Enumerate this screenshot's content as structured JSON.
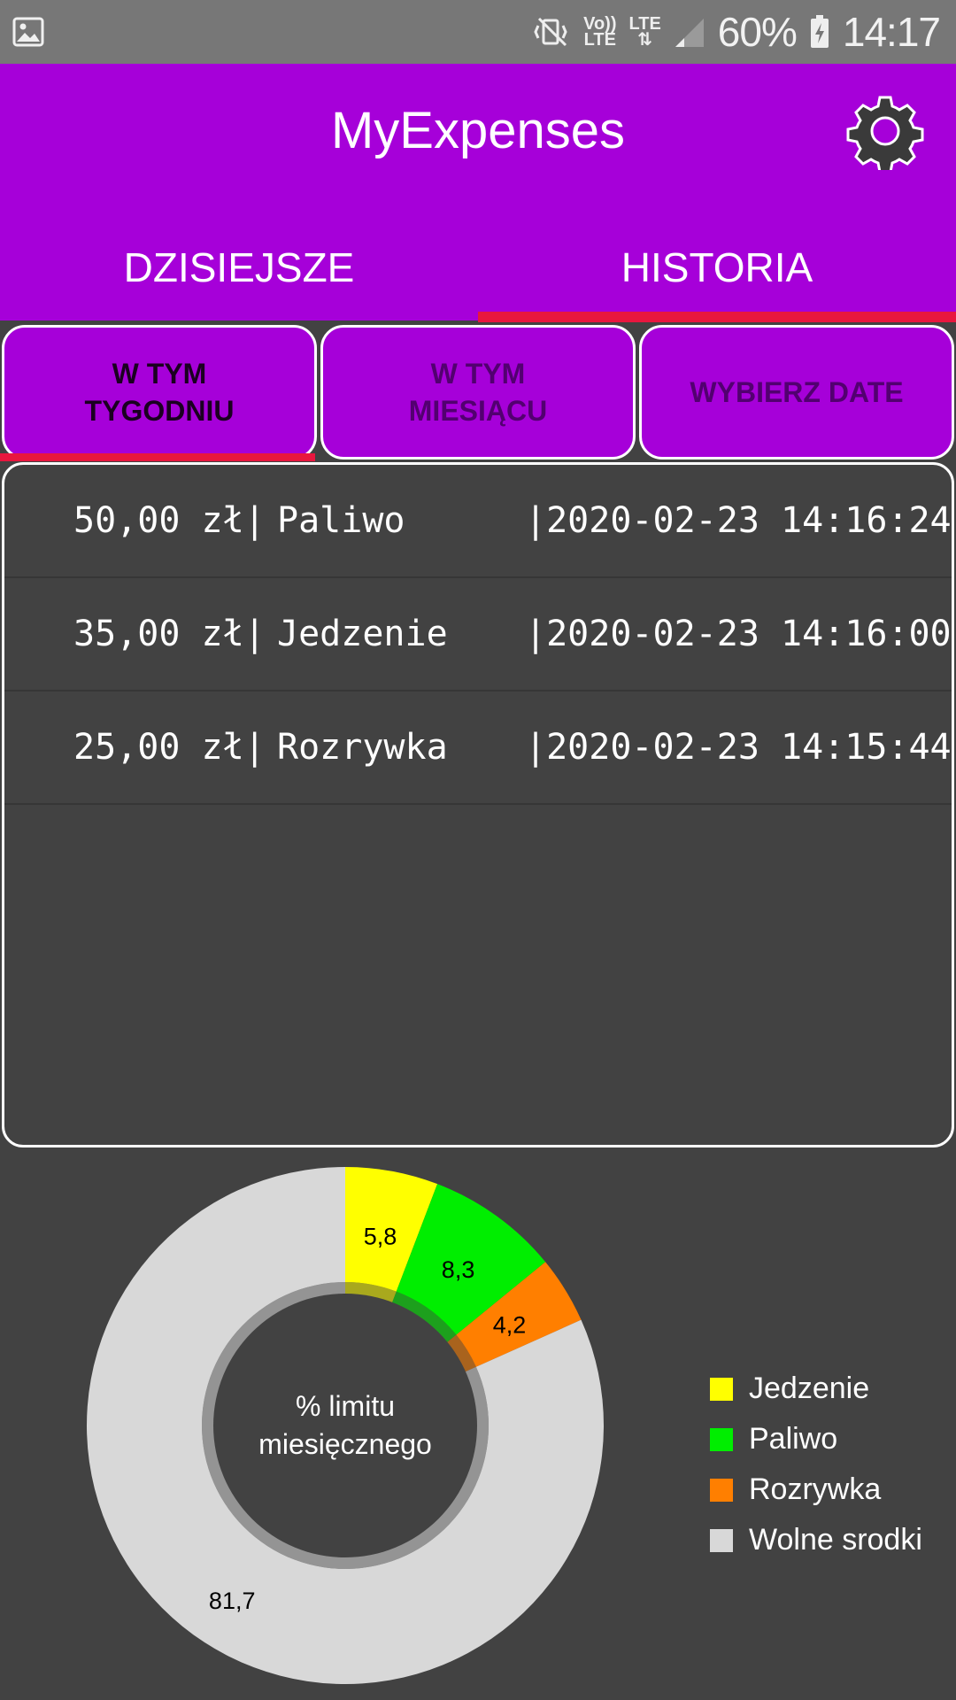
{
  "status_bar": {
    "battery": "60%",
    "time": "14:17",
    "volte_top": "Vo))",
    "volte_bottom": "LTE",
    "lte": "LTE"
  },
  "app": {
    "title": "MyExpenses"
  },
  "main_tabs": [
    {
      "label": "DZISIEJSZE",
      "selected": false
    },
    {
      "label": "HISTORIA",
      "selected": true
    }
  ],
  "sub_tabs": [
    {
      "line1": "W TYM",
      "line2": "TYGODNIU",
      "selected": true
    },
    {
      "line1": "W TYM",
      "line2": "MIESIĄCU",
      "selected": false
    },
    {
      "line1": "WYBIERZ DATE",
      "line2": "",
      "selected": false
    }
  ],
  "expenses": [
    {
      "amount": "50,00 zł|",
      "category": "Paliwo",
      "date": "|2020-02-23 14:16:24"
    },
    {
      "amount": "35,00 zł|",
      "category": "Jedzenie",
      "date": "|2020-02-23 14:16:00"
    },
    {
      "amount": "25,00 zł|",
      "category": "Rozrywka",
      "date": "|2020-02-23 14:15:44"
    }
  ],
  "chart_data": {
    "type": "pie",
    "center_text": [
      "% limitu",
      "miesięcznego"
    ],
    "categories": [
      "Jedzenie",
      "Paliwo",
      "Rozrywka",
      "Wolne srodki"
    ],
    "values": [
      5.8,
      8.3,
      4.2,
      81.7
    ],
    "value_labels": [
      "5,8",
      "8,3",
      "4,2",
      "81,7"
    ],
    "colors": [
      "#ffff00",
      "#00ee00",
      "#ff7f00",
      "#d8d8d8"
    ],
    "legend_placement": "right"
  },
  "colors": {
    "accent": "#a600d9",
    "indicator": "#e8173e",
    "background": "#424242"
  }
}
